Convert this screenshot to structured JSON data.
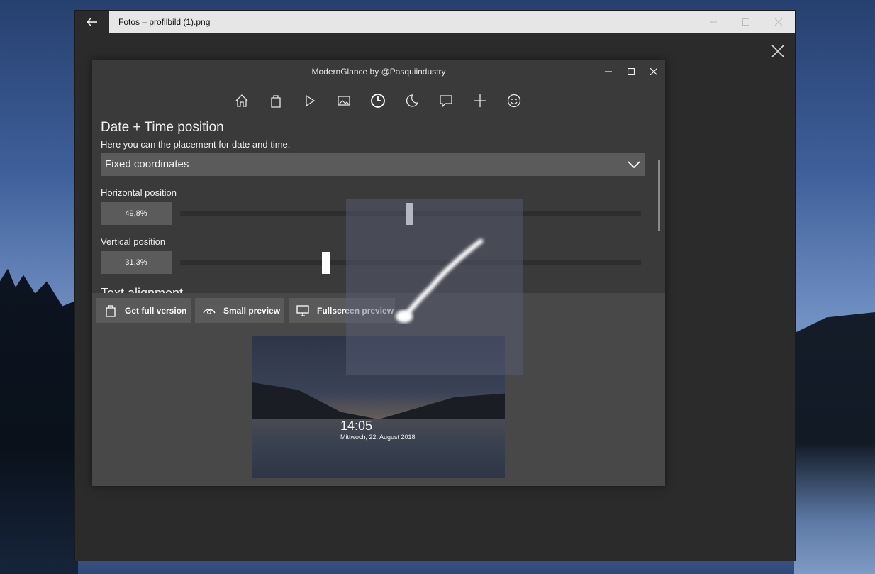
{
  "photos_window": {
    "title": "Fotos – profilbild (1).png",
    "back_icon": "arrow-left-icon",
    "controls": [
      "minimize-icon",
      "maximize-icon",
      "close-icon"
    ]
  },
  "app": {
    "title": "ModernGlance by @Pasquiindustry",
    "controls": [
      "minimize-icon",
      "maximize-icon",
      "close-icon"
    ],
    "nav_icons": [
      "home-icon",
      "shopping-bag-icon",
      "play-icon",
      "image-icon",
      "clock-icon",
      "moon-icon",
      "speech-bubble-icon",
      "plus-icon",
      "smiley-icon"
    ],
    "active_nav": "clock-icon"
  },
  "settings": {
    "heading": "Date + Time position",
    "description": "Here you can the placement for date and time.",
    "mode_select": {
      "value": "Fixed coordinates"
    },
    "horizontal": {
      "label": "Horizontal position",
      "value_text": "49,8%",
      "value": 0.498
    },
    "vertical": {
      "label": "Vertical position",
      "value_text": "31,3%",
      "value": 0.313
    },
    "next_heading": "Text alignment"
  },
  "actions": {
    "full_version": "Get full version",
    "small_preview": "Small preview",
    "fullscreen_preview": "Fullscreen preview"
  },
  "preview": {
    "time": "14:05",
    "date": "Mittwoch, 22. August 2018"
  },
  "colors": {
    "app_background": "#3a3a3a",
    "control_fill": "#5b5b5b",
    "photos_background": "#2b2b2b"
  }
}
